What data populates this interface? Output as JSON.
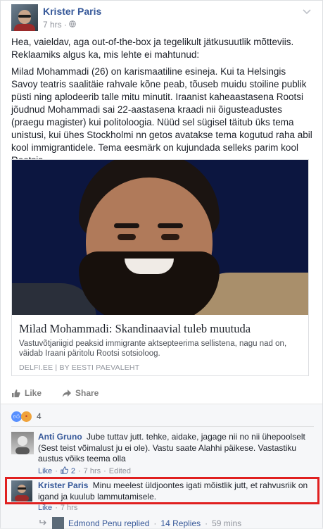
{
  "post": {
    "author": "Krister Paris",
    "time": "7 hrs",
    "audience_icon": "globe-icon",
    "paragraph1": "Hea, vaieldav, aga out-of-the-box ja tegelikult jätkusuutlik mõtteviis. Reklaamiks algus ka, mis lehte ei mahtunud:",
    "paragraph2": "Milad Mohammadi (26) on karismaatiline esineja. Kui ta Helsingis Savoy teatris saalitäie rahvale kõne peab, tõuseb muidu stoiline publik püsti ning aplodeerib talle mitu minutit. Iraanist kaheaastasena Rootsi jõudnud Mohammadi sai 22-aastasena kraadi nii õigusteadustes (praegu magister) kui politoloogia. Nüüd sel sügisel täitub üks tema unistusi, kui ühes Stockholmi nn getos avatakse tema kogutud raha abil kool immigrantidele. Tema eesmärk on kujundada selleks parim kool Rootsis."
  },
  "link_card": {
    "title": "Milad Mohammadi: Skandinaavial tuleb muutuda",
    "description": "Vastuvõtjariigid peaksid immigrante aktsepteerima sellistena, nagu nad on, väidab Iraani päritolu Rootsi sotsioloog.",
    "source": "DELFI.EE | BY EESTI PAEVALEHT"
  },
  "actions": {
    "like": "Like",
    "share": "Share"
  },
  "reactions": {
    "count": "4"
  },
  "comments": [
    {
      "name": "Anti Gruno",
      "text": "Jube tuttav jutt. tehke, aidake, jagage nii no nii ühepoolselt (Sest teist võimalust ju ei ole). Vastu saate Alahhi päikese. Vastastiku austus võiks teema olla",
      "like": "Like",
      "likes": "2",
      "time": "7 hrs",
      "edited": "Edited"
    },
    {
      "name": "Krister Paris",
      "text": "Minu meelest üldjoontes igati mõistlik jutt, et rahvusriik on igand ja kuulub lammutamisele.",
      "like": "Like",
      "time": "7 hrs"
    }
  ],
  "reply_summary": {
    "text": "Edmond Penu replied",
    "replies": "14 Replies",
    "time": "59 mins"
  },
  "colors": {
    "link_blue": "#365899",
    "highlight_red": "#e02020"
  }
}
